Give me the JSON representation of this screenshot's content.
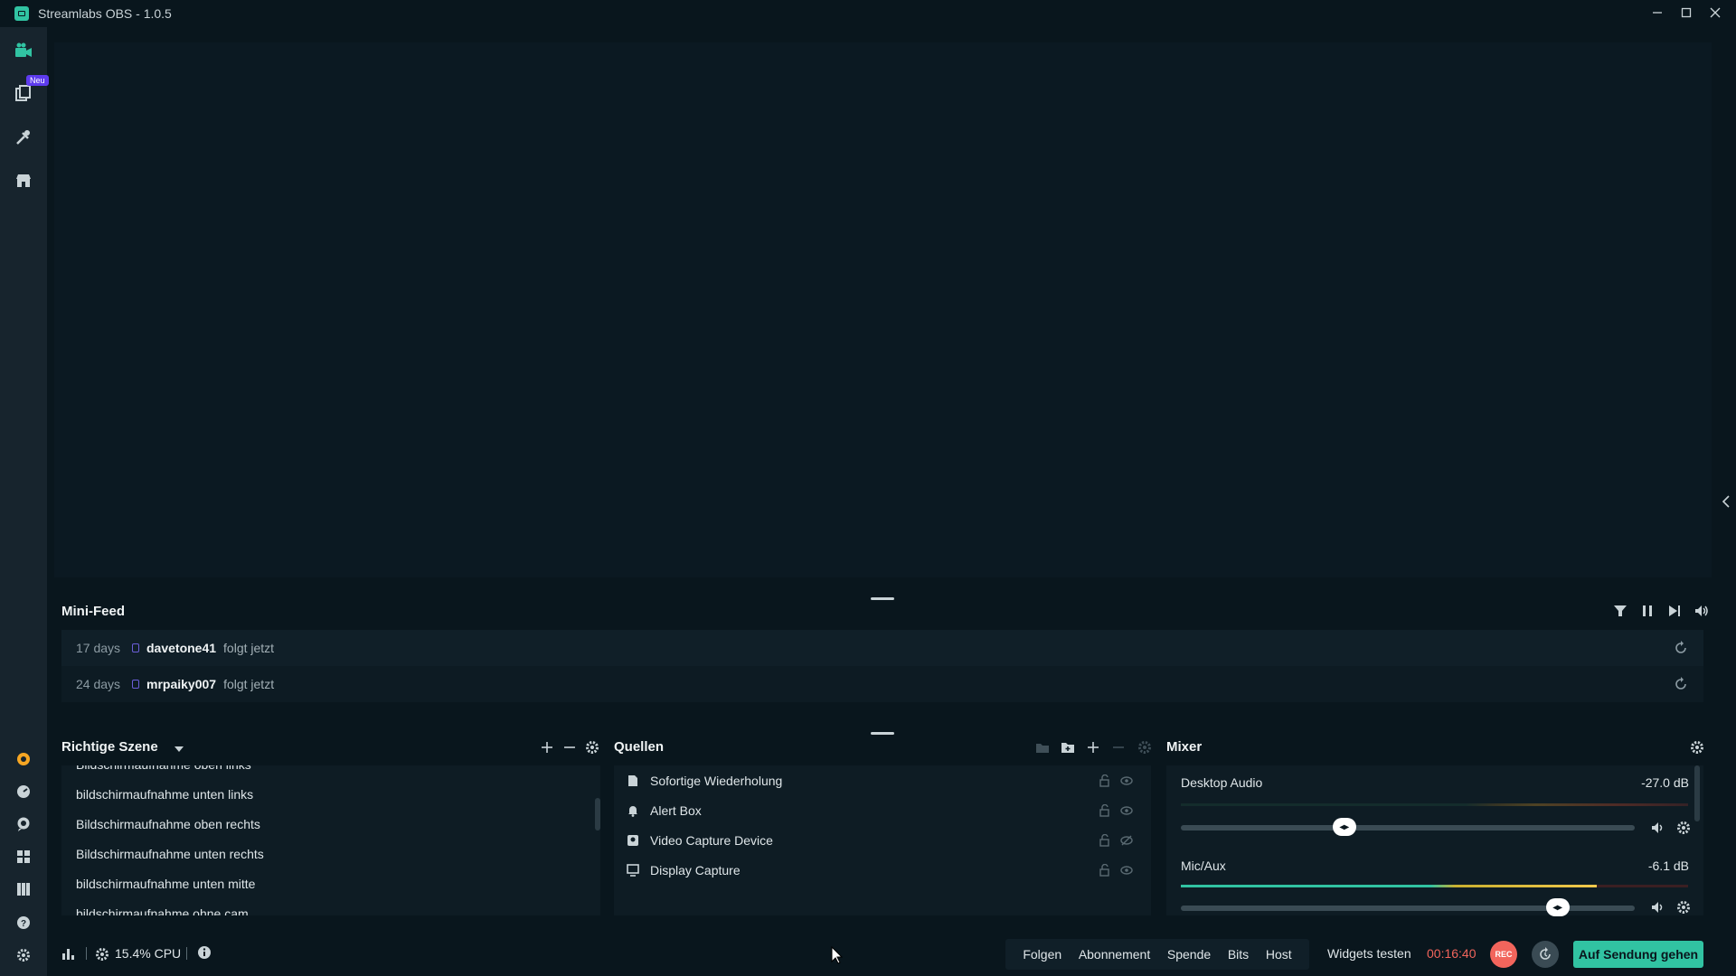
{
  "window": {
    "title": "Streamlabs OBS - 1.0.5"
  },
  "leftnav": {
    "badge": "Neu"
  },
  "colors": {
    "accent": "#31c3a2",
    "rec": "#f2655c",
    "badge": "#5e3bee",
    "background": "#09161d"
  },
  "minifeed": {
    "title": "Mini-Feed",
    "rows": [
      {
        "time": "17 days",
        "user": "davetone41",
        "action": "folgt jetzt"
      },
      {
        "time": "24 days",
        "user": "mrpaiky007",
        "action": "folgt jetzt"
      }
    ]
  },
  "scenes": {
    "title": "Richtige Szene",
    "items": [
      "Bildschirmaufnahme oben links",
      "bildschirmaufnahme unten links",
      "Bildschirmaufnahme oben rechts",
      "Bildschirmaufnahme unten rechts",
      "bildschirmaufnahme unten mitte",
      "bildschirmaufnahme ohne cam"
    ]
  },
  "sources": {
    "title": "Quellen",
    "items": [
      {
        "label": "Sofortige Wiederholung",
        "icon": "file-icon"
      },
      {
        "label": "Alert Box",
        "icon": "bell-icon"
      },
      {
        "label": "Video Capture Device",
        "icon": "webcam-icon"
      },
      {
        "label": "Display Capture",
        "icon": "monitor-icon"
      }
    ]
  },
  "mixer": {
    "title": "Mixer",
    "channels": [
      {
        "name": "Desktop Audio",
        "db": "-27.0 dB",
        "volume": 0.36
      },
      {
        "name": "Mic/Aux",
        "db": "-6.1 dB",
        "volume": 0.83
      }
    ]
  },
  "statusbar": {
    "cpu": "15.4% CPU",
    "tests": [
      "Folgen",
      "Abonnement",
      "Spende",
      "Bits",
      "Host"
    ],
    "widgets_label": "Widgets testen",
    "timer": "00:16:40",
    "rec_label": "REC",
    "go_live": "Auf Sendung gehen"
  }
}
